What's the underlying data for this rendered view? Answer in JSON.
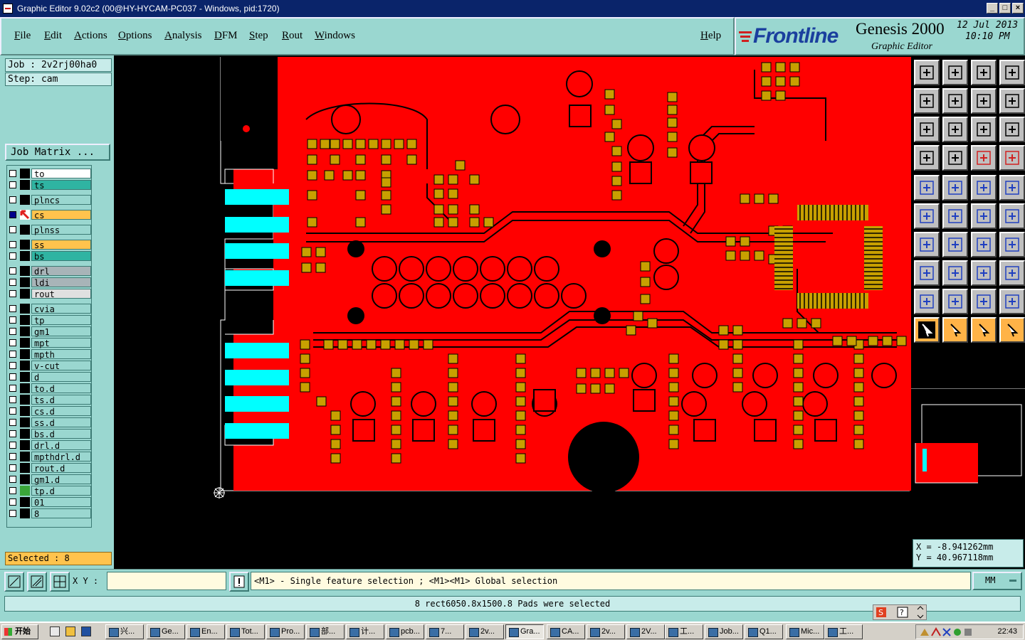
{
  "window": {
    "title": "Graphic Editor 9.02c2 (00@HY-HYCAM-PC037 - Windows, pid:1720)",
    "controls": [
      "_",
      "□",
      "×"
    ]
  },
  "menu": {
    "items": [
      "File",
      "Edit",
      "Actions",
      "Options",
      "Analysis",
      "DFM",
      "Step",
      "Rout",
      "Windows"
    ],
    "help": "Help"
  },
  "brand": {
    "company": "Frontline",
    "product": "Genesis 2000",
    "subtitle": "Graphic Editor",
    "date": "12 Jul 2013",
    "time": "10:10 PM"
  },
  "job": {
    "job_label": "Job : 2v2rj00ha0",
    "step_label": "Step: cam",
    "matrix_button": "Job Matrix ..."
  },
  "layers": [
    {
      "name": "to",
      "color": "#ffffff",
      "checked": false,
      "mark": "black"
    },
    {
      "name": "ts",
      "color": "#2fb4a2",
      "checked": false,
      "mark": "black"
    },
    {
      "name": "plncs",
      "color": "#9ad7d0",
      "checked": false,
      "mark": "black"
    },
    {
      "name": "cs",
      "color": "#ffc34d",
      "checked": true,
      "mark": "red-arrow"
    },
    {
      "name": "plnss",
      "color": "#9ad7d0",
      "checked": false,
      "mark": "black"
    },
    {
      "name": "ss",
      "color": "#ffc34d",
      "checked": false,
      "mark": "black"
    },
    {
      "name": "bs",
      "color": "#2fb4a2",
      "checked": false,
      "mark": "black"
    },
    {
      "name": "drl",
      "color": "#a8b4b8",
      "checked": false,
      "mark": "black"
    },
    {
      "name": "ldi",
      "color": "#a8b4b8",
      "checked": false,
      "mark": "black"
    },
    {
      "name": "rout",
      "color": "#e0e0e0",
      "checked": false,
      "mark": "black"
    },
    {
      "name": "cvia",
      "color": "#9ad7d0",
      "checked": false,
      "mark": "black"
    },
    {
      "name": "tp",
      "color": "#9ad7d0",
      "checked": false,
      "mark": "black"
    },
    {
      "name": "gm1",
      "color": "#9ad7d0",
      "checked": false,
      "mark": "black"
    },
    {
      "name": "mpt",
      "color": "#9ad7d0",
      "checked": false,
      "mark": "black"
    },
    {
      "name": "mpth",
      "color": "#9ad7d0",
      "checked": false,
      "mark": "black"
    },
    {
      "name": "v-cut",
      "color": "#9ad7d0",
      "checked": false,
      "mark": "black"
    },
    {
      "name": "d",
      "color": "#9ad7d0",
      "checked": false,
      "mark": "black"
    },
    {
      "name": "to.d",
      "color": "#9ad7d0",
      "checked": false,
      "mark": "black"
    },
    {
      "name": "ts.d",
      "color": "#9ad7d0",
      "checked": false,
      "mark": "black"
    },
    {
      "name": "cs.d",
      "color": "#9ad7d0",
      "checked": false,
      "mark": "black"
    },
    {
      "name": "ss.d",
      "color": "#9ad7d0",
      "checked": false,
      "mark": "black"
    },
    {
      "name": "bs.d",
      "color": "#9ad7d0",
      "checked": false,
      "mark": "black"
    },
    {
      "name": "drl.d",
      "color": "#9ad7d0",
      "checked": false,
      "mark": "black"
    },
    {
      "name": "mpthdrl.d",
      "color": "#9ad7d0",
      "checked": false,
      "mark": "black"
    },
    {
      "name": "rout.d",
      "color": "#9ad7d0",
      "checked": false,
      "mark": "black"
    },
    {
      "name": "gm1.d",
      "color": "#9ad7d0",
      "checked": false,
      "mark": "black"
    },
    {
      "name": "tp.d",
      "color": "#9ad7d0",
      "checked": false,
      "mark": "green"
    },
    {
      "name": "01",
      "color": "#9ad7d0",
      "checked": false,
      "mark": "black"
    },
    {
      "name": "8",
      "color": "#9ad7d0",
      "checked": false,
      "mark": "black"
    }
  ],
  "selection": {
    "label": "Selected : 8"
  },
  "coordinates": {
    "x": "X = -8.941262mm",
    "y": "Y = 40.967118mm"
  },
  "input": {
    "xy_label": "X Y :",
    "xy_value": ""
  },
  "message": "<M1> - Single feature selection ; <M1><M1> Global selection",
  "units": "MM",
  "status": "8 rect6050.8x1500.8 Pads were selected",
  "colors": {
    "copper": "#ff0000",
    "pad": "#c8a000",
    "finger": "#00ffff",
    "panel": "#9ad7d0"
  },
  "taskbar": {
    "start": "开始",
    "tasks": [
      "兴...",
      "Ge...",
      "En...",
      "Tot...",
      "Pro...",
      "部...",
      "计...",
      "pcb...",
      "7...",
      "2v...",
      "Gra...",
      "CA...",
      "2v...",
      "2V...",
      "工...",
      "Job...",
      "Q1...",
      "Mic...",
      "工..."
    ],
    "clock": "22:43"
  }
}
